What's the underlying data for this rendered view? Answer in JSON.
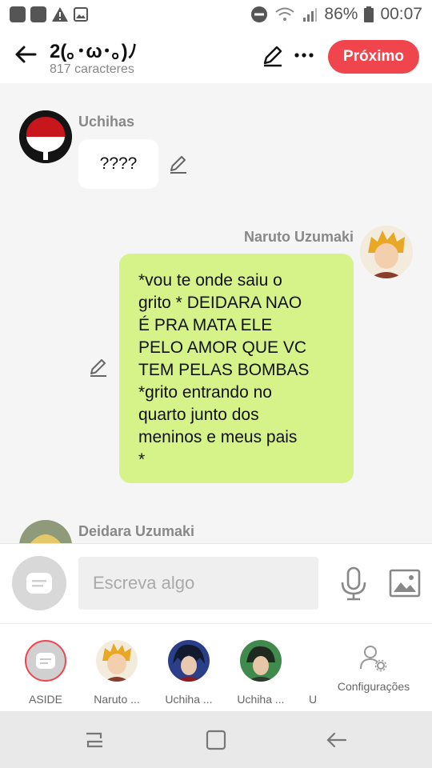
{
  "status": {
    "battery": "86%",
    "time": "00:07"
  },
  "header": {
    "title": "2(｡･ω･｡)ﾉ",
    "subtitle": "817 caracteres",
    "next_label": "Próximo"
  },
  "messages": [
    {
      "author": "Uchihas",
      "text": "????"
    },
    {
      "author": "Naruto Uzumaki",
      "text": "*vou te onde saiu o\ngrito * DEIDARA NAO\nÉ PRA MATA ELE\nPELO AMOR QUE VC\nTEM PELAS BOMBAS\n*grito entrando no\nquarto junto dos\nmeninos e meus pais\n*"
    },
    {
      "author": "Deidara Uzumaki"
    }
  ],
  "input": {
    "placeholder": "Escreva algo"
  },
  "characters": [
    {
      "label": "ASIDE"
    },
    {
      "label": "Naruto ..."
    },
    {
      "label": "Uchiha ..."
    },
    {
      "label": "Uchiha ..."
    },
    {
      "label": "U"
    },
    {
      "label": "Configurações"
    }
  ],
  "colors": {
    "accent": "#f0454c",
    "bubble_green": "#d6f38a"
  }
}
